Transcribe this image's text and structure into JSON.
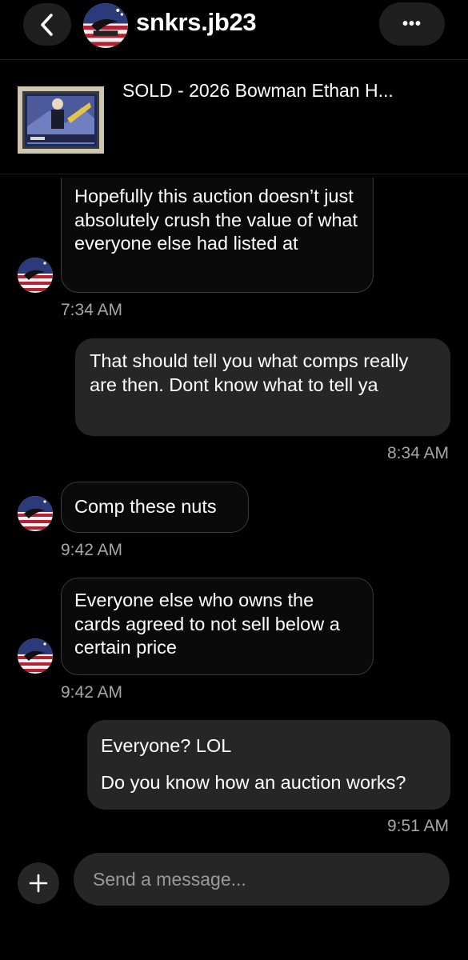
{
  "header": {
    "username": "snkrs.jb23",
    "more_label": "•••"
  },
  "listing": {
    "title": "SOLD - 2026 Bowman Ethan H..."
  },
  "messages": [
    {
      "from": "them",
      "lines": [
        "Hopefully this auction doesn’t just absolutely crush the value of what everyone else had listed at"
      ],
      "time": "7:34 AM"
    },
    {
      "from": "me",
      "lines": [
        "That should tell you what comps really are then. Dont know what to tell ya"
      ],
      "time": "8:34 AM"
    },
    {
      "from": "them",
      "lines": [
        "Comp these nuts"
      ],
      "time": "9:42 AM"
    },
    {
      "from": "them",
      "lines": [
        "Everyone else who owns the cards agreed to not sell below a certain price"
      ],
      "time": "9:42 AM"
    },
    {
      "from": "me",
      "lines": [
        "Everyone? LOL",
        "Do you know how an auction works?"
      ],
      "time": "9:51 AM"
    }
  ],
  "composer": {
    "placeholder": "Send a message..."
  },
  "icons": {
    "back": "chevron-left-icon",
    "more": "more-dots-icon",
    "add": "plus-icon"
  },
  "colors": {
    "background": "#000000",
    "sent_bubble": "#262626",
    "received_border": "#3a3a3a",
    "timestamp": "#a7a7a7"
  }
}
